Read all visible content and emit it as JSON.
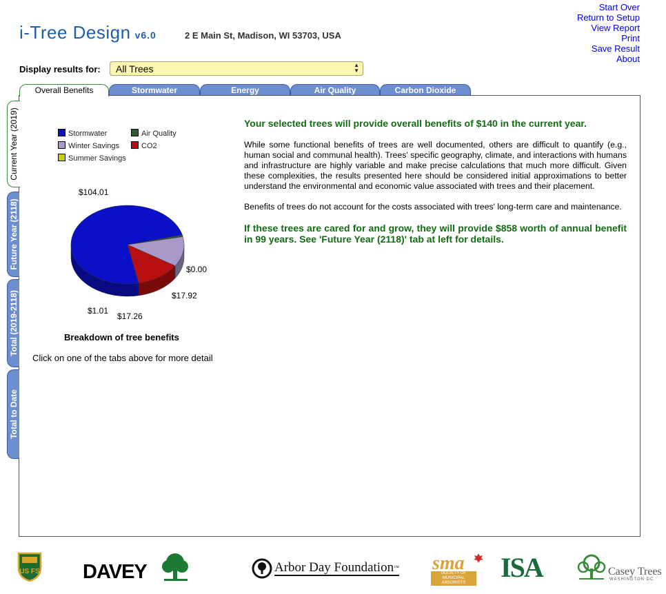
{
  "header": {
    "title": "i-Tree Design",
    "version": "v6.0",
    "address": "2 E Main St, Madison, WI 53703, USA"
  },
  "top_links": [
    "Start Over",
    "Return to Setup",
    "View Report",
    "Print",
    "Save Result",
    "About"
  ],
  "display": {
    "label": "Display results for:",
    "selected": "All Trees"
  },
  "top_tabs": [
    "Overall Benefits",
    "Stormwater",
    "Energy",
    "Air Quality",
    "Carbon Dioxide"
  ],
  "side_tabs": [
    "Current Year (2019)",
    "Future Year (2118)",
    "Total (2019-2118)",
    "Total to Date"
  ],
  "chart_data": {
    "type": "pie",
    "legend": [
      {
        "name": "Stormwater",
        "color": "#0a10c8"
      },
      {
        "name": "Air Quality",
        "color": "#2f5a2f"
      },
      {
        "name": "Winter Savings",
        "color": "#a899c8"
      },
      {
        "name": "CO2",
        "color": "#b81010"
      },
      {
        "name": "Summer Savings",
        "color": "#cccc10"
      }
    ],
    "slices": [
      {
        "name": "Stormwater",
        "value": 104.01,
        "label": "$104.01",
        "color": "#0a10c8"
      },
      {
        "name": "CO2",
        "value": 17.92,
        "label": "$17.92",
        "color": "#b81010"
      },
      {
        "name": "Winter Savings",
        "value": 17.26,
        "label": "$17.26",
        "color": "#a899c8"
      },
      {
        "name": "Air Quality",
        "value": 1.01,
        "label": "$1.01",
        "color": "#2f5a2f"
      },
      {
        "name": "Summer Savings",
        "value": 0.0,
        "label": "$0.00",
        "color": "#cccc10"
      }
    ],
    "title": "Breakdown of tree benefits"
  },
  "chart_hint": "Click on one of the tabs above for more detail",
  "content": {
    "headline": "Your selected trees will provide overall benefits of $140 in the current year.",
    "paragraph1": "While some functional benefits of trees are well documented, others are difficult to quantify (e.g., human social and communal health). Trees' specific geography, climate, and interactions with humans and infrastructure are highly variable and make precise calculations that much more difficult. Given these complexities, the results presented here should be considered initial approximations to better understand the environmental and economic value associated with trees and their placement.",
    "paragraph2": "Benefits of trees do not account for the costs associated with trees' long-term care and maintenance.",
    "footline": "If these trees are cared for and grow, they will provide $858 worth of annual benefit in 99 years. See 'Future Year (2118)' tab at left for details."
  },
  "footer_logos": {
    "usfs": "US FS",
    "davey": "DAVEY",
    "arbor_day": "Arbor Day Foundation",
    "arbor_day_mark": "™",
    "sma": "sma",
    "sma_sub": "SOCIETY OF MUNICIPAL ARBORISTS",
    "isa": "ISA",
    "casey": "Casey Trees",
    "casey_sub": "WASHINGTON DC"
  }
}
